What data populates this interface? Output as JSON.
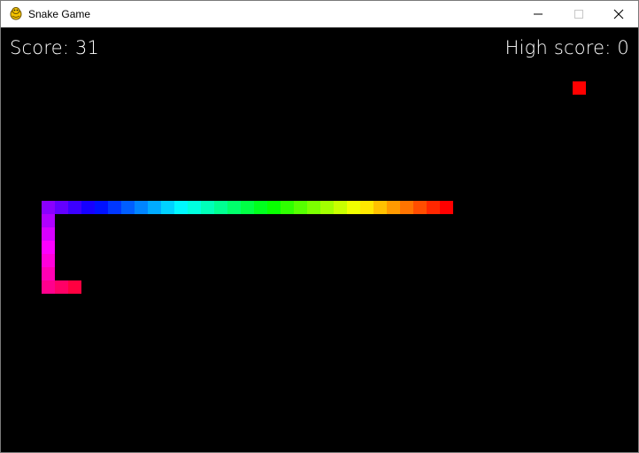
{
  "window": {
    "title": "Snake Game",
    "icon": "pygame-snake-icon",
    "buttons": [
      "minimize-icon",
      "maximize-icon",
      "close-icon"
    ]
  },
  "hud": {
    "score": "Score: 31",
    "high_score": "High score: 0"
  },
  "colors": {
    "background": "#000000",
    "food": "#ff0000",
    "text": "#ffffff"
  },
  "grid": {
    "cell": 15,
    "origin_x": 1,
    "origin_y": 1,
    "food": [
      43,
      4
    ],
    "snake_color_hues": "rainbow-gradient head-red-to-tail-red",
    "snake": [
      [
        33,
        13
      ],
      [
        32,
        13
      ],
      [
        31,
        13
      ],
      [
        30,
        13
      ],
      [
        29,
        13
      ],
      [
        28,
        13
      ],
      [
        27,
        13
      ],
      [
        26,
        13
      ],
      [
        25,
        13
      ],
      [
        24,
        13
      ],
      [
        23,
        13
      ],
      [
        22,
        13
      ],
      [
        21,
        13
      ],
      [
        20,
        13
      ],
      [
        19,
        13
      ],
      [
        18,
        13
      ],
      [
        17,
        13
      ],
      [
        16,
        13
      ],
      [
        15,
        13
      ],
      [
        14,
        13
      ],
      [
        13,
        13
      ],
      [
        12,
        13
      ],
      [
        11,
        13
      ],
      [
        10,
        13
      ],
      [
        9,
        13
      ],
      [
        8,
        13
      ],
      [
        7,
        13
      ],
      [
        6,
        13
      ],
      [
        5,
        13
      ],
      [
        4,
        13
      ],
      [
        3,
        13
      ],
      [
        3,
        14
      ],
      [
        3,
        15
      ],
      [
        3,
        16
      ],
      [
        3,
        17
      ],
      [
        3,
        18
      ],
      [
        3,
        19
      ],
      [
        4,
        19
      ],
      [
        5,
        19
      ]
    ]
  }
}
